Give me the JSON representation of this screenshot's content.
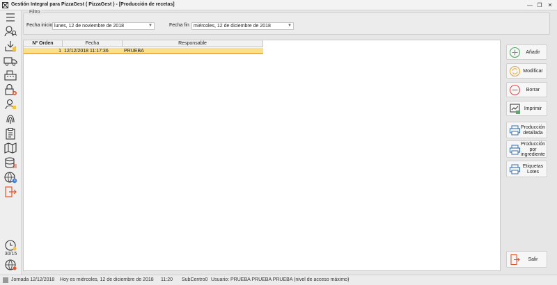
{
  "window": {
    "title": "Gestión Integral para PizzaGest ( PizzaGest ) - [Producción de recetas]",
    "minimize": "—",
    "restore": "❐",
    "close": "✕"
  },
  "sidebar": {
    "icons": [
      "menu-icon",
      "search-person-icon",
      "download-icon",
      "truck-icon",
      "cash-register-icon",
      "lock-icon",
      "contacts-icon",
      "fingerprint-icon",
      "clipboard-icon",
      "map-icon",
      "database-icon",
      "world-clock-icon",
      "exit-icon"
    ],
    "bottom_icons": [
      "clock-icon",
      "globe-icon"
    ],
    "counter": "30/15"
  },
  "filter": {
    "legend": "Filtro",
    "start_label": "Fecha inicio",
    "start_value": "lunes, 12 de noviembre de 2018",
    "end_label": "Fecha fin",
    "end_value": "miércoles, 12 de diciembre de 2018"
  },
  "table": {
    "columns": [
      "Nº Orden",
      "Fecha",
      "Responsable"
    ],
    "rows": [
      {
        "orden": "1",
        "fecha": "12/12/2018 11:17:36",
        "responsable": "PRUEBA"
      }
    ]
  },
  "actions": {
    "add": "Añadir",
    "modify": "Modificar",
    "delete": "Borrar",
    "print": "Imprimir",
    "detailed_line1": "Producción",
    "detailed_line2": "detallada",
    "by_ingredient_line1": "Producción",
    "by_ingredient_line2": "por",
    "by_ingredient_line3": "ingrediente",
    "labels_line1": "Etiquetas",
    "labels_line2": "Lotes",
    "exit": "Salir"
  },
  "statusbar": {
    "jornada": "Jornada 12/12/2018",
    "today": "Hoy es miércoles, 12 de diciembre de 2018",
    "time": "11:20",
    "subcentro": "SubCentro0",
    "user": "Usuario: PRUEBA PRUEBA PRUEBA (nivel de acceso máximo)"
  },
  "colors": {
    "selected_row": "#fae08a",
    "selected_row_border": "#f0b43a",
    "icon_accent": "#e2542a",
    "add_green": "#5aa86b",
    "delete_red": "#d9534f"
  }
}
